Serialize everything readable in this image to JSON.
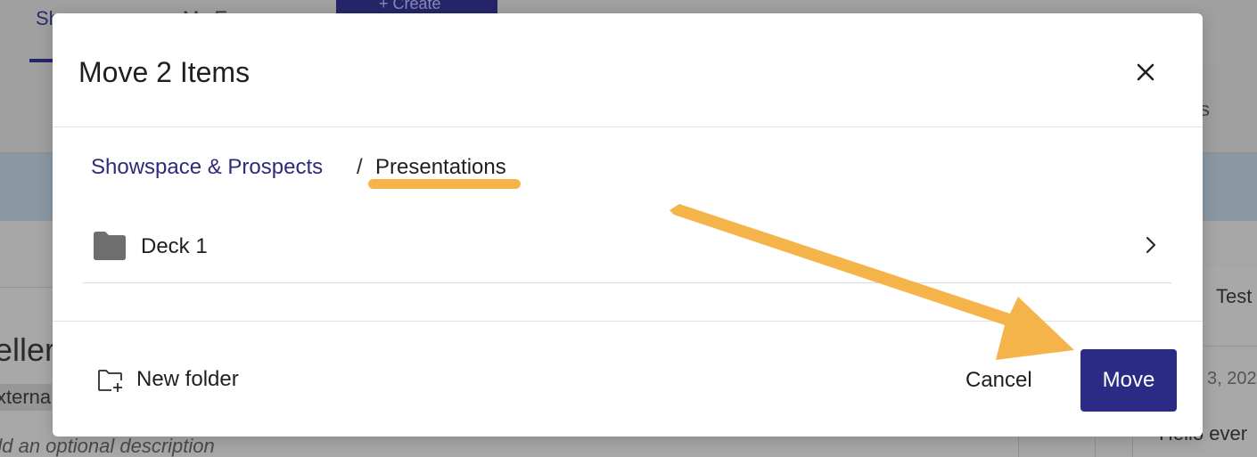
{
  "background": {
    "tabs": [
      "Sh",
      "My E"
    ],
    "create_label": "+ Create",
    "subbar_right_text": "s",
    "card_title": "eller",
    "card_tag": "xterna",
    "card_description": "dd an optional description",
    "right_title": "Test",
    "right_date": "3, 202",
    "right_message": "Hello ever"
  },
  "modal": {
    "title": "Move 2 Items",
    "close_icon": "close-icon",
    "breadcrumb": {
      "parent": "Showspace & Prospects",
      "separator": "/",
      "current": "Presentations"
    },
    "folders": [
      {
        "name": "Deck 1",
        "icon": "folder-icon",
        "chevron": "chevron-right-icon"
      }
    ],
    "footer": {
      "new_folder_label": "New folder",
      "new_folder_icon": "folder-plus-icon",
      "cancel_label": "Cancel",
      "move_label": "Move"
    }
  },
  "colors": {
    "primary": "#2b2a85",
    "link": "#2d2b7a",
    "annotation": "#f4b44a",
    "folder_icon": "#6e6e6e"
  }
}
